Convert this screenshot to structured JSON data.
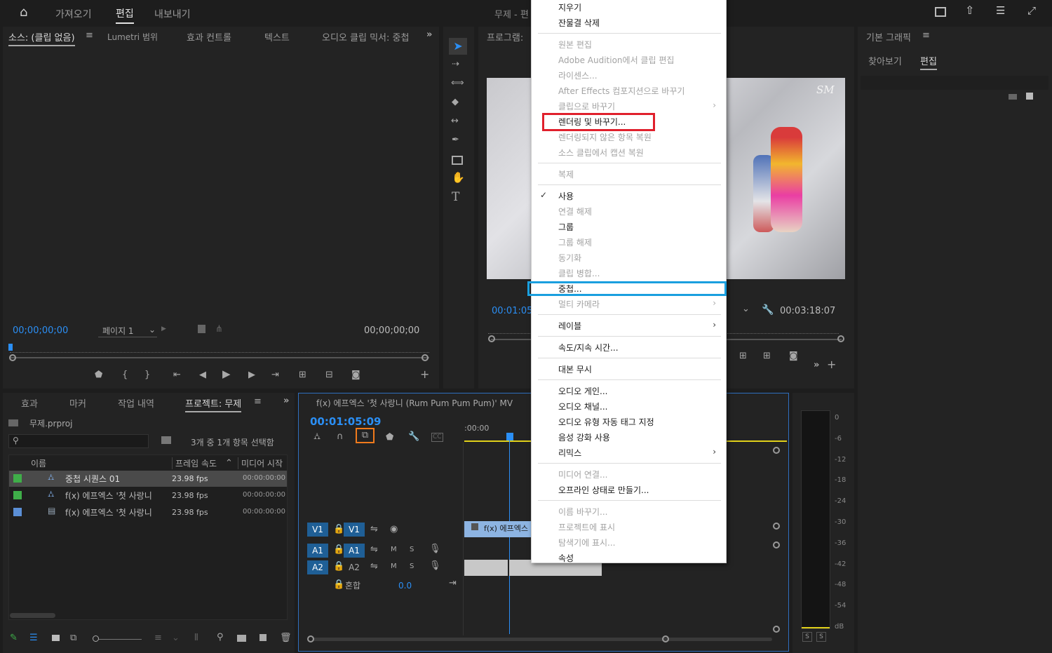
{
  "topbar": {
    "home_icon": "home-icon",
    "tabs": [
      "가져오기",
      "편집",
      "내보내기"
    ],
    "active_tab": "편집",
    "doc_title": "무제 - 편"
  },
  "source_panel": {
    "tabs": [
      "소스: (클립 없음)",
      "Lumetri 범위",
      "효과 컨트롤",
      "텍스트",
      "오디오 클립 믹서: 중첩"
    ],
    "timecode_left": "00;00;00;00",
    "page": "페이지 1",
    "timecode_right": "00;00;00;00"
  },
  "program_panel": {
    "title": "프로그램: ",
    "timecode_left": "00:01:05",
    "timecode_right": "00:03:18:07"
  },
  "right_panel": {
    "title": "기본 그래픽",
    "tabs": [
      "찾아보기",
      "편집"
    ],
    "active_tab": "편집"
  },
  "project_panel": {
    "tabs": [
      "효과",
      "마커",
      "작업 내역",
      "프로젝트: 무제"
    ],
    "active_tab": "프로젝트: 무제",
    "file": "무제.prproj",
    "selection_info": "3개 중 1개 항목 선택함",
    "columns": [
      "이름",
      "프레임 속도",
      "미디어 시작"
    ],
    "rows": [
      {
        "color": "#3fae49",
        "name": "중첩 시퀀스 01",
        "fps": "23.98 fps",
        "start": "00:00:00:00"
      },
      {
        "color": "#3fae49",
        "name": "f(x) 에프엑스 '첫 사랑니",
        "fps": "23.98 fps",
        "start": "00:00:00:00"
      },
      {
        "color": "#5b8fd6",
        "name": "f(x) 에프엑스 '첫 사랑니",
        "fps": "23.98 fps",
        "start": "00:00:00:00"
      }
    ]
  },
  "timeline": {
    "title": "f(x) 에프엑스 '첫 사랑니 (Rum Pum Pum Pum)' MV",
    "timecode": "00:01:05:09",
    "ruler_start": ":00:00",
    "tracks": {
      "v1_src": "V1",
      "v1": "V1",
      "a1_src": "A1",
      "a1": "A1",
      "a2_src": "A2",
      "a2": "A2",
      "mute": "M",
      "solo": "S",
      "mix_label": "혼합",
      "mix_value": "0.0"
    },
    "clip_label": "f(x) 에프엑스"
  },
  "meter": {
    "scale": [
      "0",
      "-6",
      "-12",
      "-18",
      "-24",
      "-30",
      "-36",
      "-42",
      "-48",
      "-54",
      "dB"
    ],
    "solo_buttons": [
      "S",
      "S"
    ]
  },
  "context_menu": {
    "items": [
      {
        "label": "지우기",
        "enabled": true
      },
      {
        "label": "잔물결 삭제",
        "enabled": true
      },
      {
        "sep": true
      },
      {
        "label": "원본 편집",
        "enabled": false
      },
      {
        "label": "Adobe Audition에서 클립 편집",
        "enabled": false
      },
      {
        "label": "라이센스...",
        "enabled": false
      },
      {
        "label": "After Effects 컴포지션으로 바꾸기",
        "enabled": false
      },
      {
        "label": "클립으로 바꾸기",
        "enabled": false,
        "submenu": true
      },
      {
        "label": "렌더링 및 바꾸기...",
        "enabled": true,
        "highlight": "red"
      },
      {
        "label": "렌더링되지 않은 항목 복원",
        "enabled": false
      },
      {
        "label": "소스 클립에서 캡션 복원",
        "enabled": false
      },
      {
        "sep": true
      },
      {
        "label": "복제",
        "enabled": false
      },
      {
        "sep": true
      },
      {
        "label": "사용",
        "enabled": true,
        "checked": true
      },
      {
        "label": "연결 해제",
        "enabled": false
      },
      {
        "label": "그룹",
        "enabled": true
      },
      {
        "label": "그룹 해제",
        "enabled": false
      },
      {
        "label": "동기화",
        "enabled": false
      },
      {
        "label": "클립 병합...",
        "enabled": false
      },
      {
        "label": "중첩...",
        "enabled": true,
        "highlight": "blue"
      },
      {
        "label": "멀티 카메라",
        "enabled": false,
        "submenu": true
      },
      {
        "sep": true
      },
      {
        "label": "레이블",
        "enabled": true,
        "submenu": true
      },
      {
        "sep": true
      },
      {
        "label": "속도/지속 시간...",
        "enabled": true
      },
      {
        "sep": true
      },
      {
        "label": "대본 무시",
        "enabled": true
      },
      {
        "sep": true
      },
      {
        "label": "오디오 게인...",
        "enabled": true
      },
      {
        "label": "오디오 채널...",
        "enabled": true
      },
      {
        "label": "오디오 유형 자동 태그 지정",
        "enabled": true
      },
      {
        "label": "음성 강화 사용",
        "enabled": true
      },
      {
        "label": "리믹스",
        "enabled": true,
        "submenu": true
      },
      {
        "sep": true
      },
      {
        "label": "미디어 연결...",
        "enabled": false
      },
      {
        "label": "오프라인 상태로 만들기...",
        "enabled": true
      },
      {
        "sep": true
      },
      {
        "label": "이름 바꾸기...",
        "enabled": false
      },
      {
        "label": "프로젝트에 표시",
        "enabled": false
      },
      {
        "label": "탐색기에 표시...",
        "enabled": false
      },
      {
        "label": "속성",
        "enabled": true
      }
    ]
  },
  "colors": {
    "accent_blue": "#2b8ff5",
    "highlight_red": "#e0202c",
    "highlight_blue": "#1a9fdf",
    "highlight_orange": "#f07a1c",
    "track_blue": "#1f5f96"
  }
}
